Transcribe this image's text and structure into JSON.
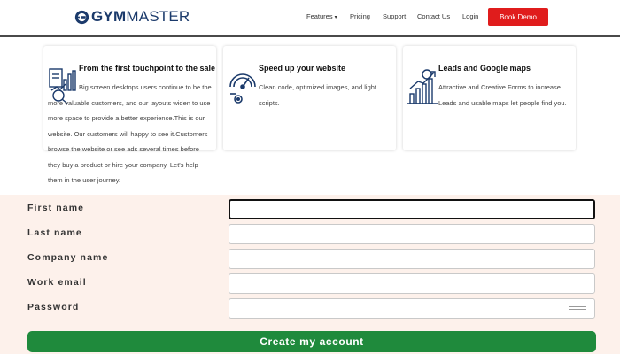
{
  "brand": {
    "logo_text_bold": "GYM",
    "logo_text_light": "MASTER"
  },
  "nav": {
    "items": [
      "Features",
      "Pricing",
      "Support",
      "Contact Us",
      "Login"
    ],
    "cta": "Book Demo"
  },
  "features": [
    {
      "icon": "analytics-chart-icon",
      "title": "From the first touchpoint to the sale",
      "body": "Big screen desktops users continue to be the more valuable customers, and our layouts widen to use more space to provide a better experience.This is our website. Our customers will happy to see it.Customers browse the website or see ads several times before they buy a product or hire your company. Let's help them in the user journey."
    },
    {
      "icon": "speedometer-icon",
      "title": "Speed up your website",
      "body": "Clean code, optimized images, and light scripts."
    },
    {
      "icon": "growth-chart-icon",
      "title": "Leads and Google maps",
      "body": "Attractive and Creative Forms to increase Leads and usable maps let people find you."
    }
  ],
  "form": {
    "fields": [
      {
        "label": "First name",
        "value": ""
      },
      {
        "label": "Last name",
        "value": ""
      },
      {
        "label": "Company name",
        "value": ""
      },
      {
        "label": "Work email",
        "value": ""
      },
      {
        "label": "Password",
        "value": ""
      }
    ],
    "submit": "Create my account"
  },
  "colors": {
    "brand_blue": "#1b3a6b",
    "cta_red": "#e01c1c",
    "submit_green": "#1f8a3c",
    "form_background": "#fdf1eb"
  }
}
